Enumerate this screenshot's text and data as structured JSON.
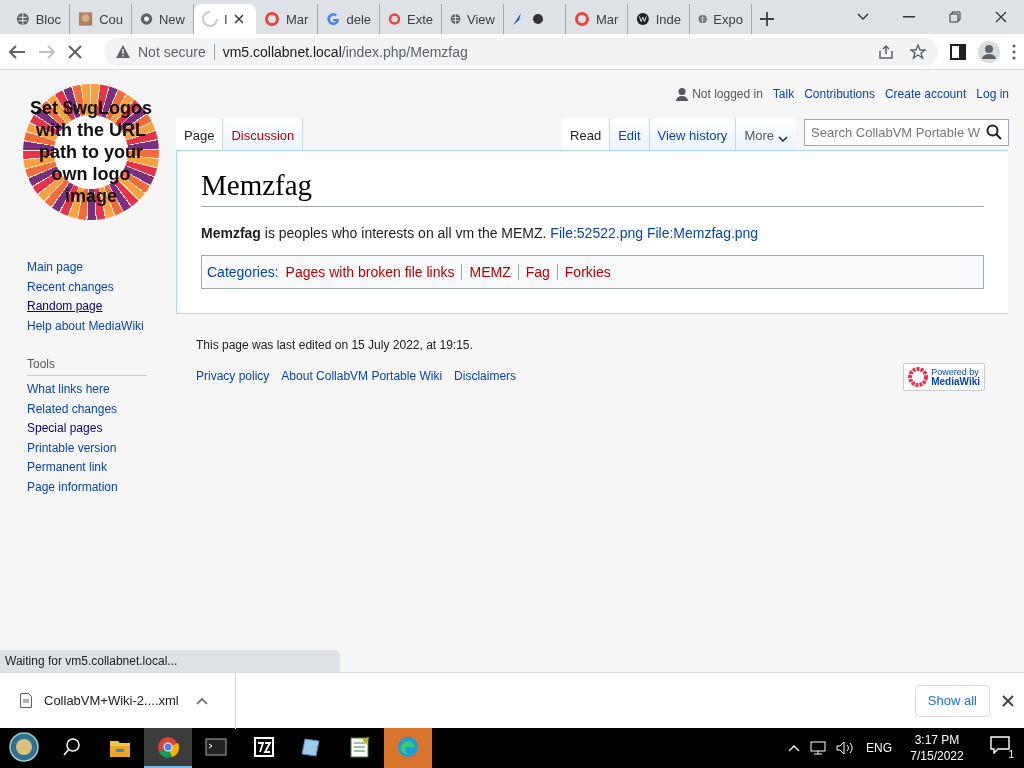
{
  "browser": {
    "tabs": [
      {
        "title": "Bloc",
        "kind": "globe",
        "selected": false
      },
      {
        "title": "Cou",
        "kind": "photo",
        "selected": false
      },
      {
        "title": "New",
        "kind": "chrome",
        "selected": false
      },
      {
        "title": "I",
        "kind": "loading",
        "selected": true
      },
      {
        "title": "Mar",
        "kind": "ring",
        "selected": false
      },
      {
        "title": "dele",
        "kind": "google",
        "selected": false
      },
      {
        "title": "Exte",
        "kind": "ring",
        "selected": false
      },
      {
        "title": "View",
        "kind": "globe",
        "selected": false
      },
      {
        "kind": "pair",
        "selected": false
      },
      {
        "title": "Mar",
        "kind": "ring",
        "selected": false
      },
      {
        "title": "Inde",
        "kind": "wiki",
        "selected": false
      },
      {
        "title": "Expo",
        "kind": "globe",
        "selected": false
      }
    ],
    "security": "Not secure",
    "url_host": "vm5.collabnet.local",
    "url_path": "/index.php/Memzfag",
    "loading": true
  },
  "wiki": {
    "logo_text": "Set $wgLogos with the URL path to your own logo image",
    "navigation": [
      {
        "label": "Main page",
        "hovered": false
      },
      {
        "label": "Recent changes",
        "hovered": false
      },
      {
        "label": "Random page",
        "hovered": true
      },
      {
        "label": "Help about MediaWiki",
        "hovered": false
      }
    ],
    "tools_heading": "Tools",
    "tools": [
      {
        "label": "What links here",
        "visited": false
      },
      {
        "label": "Related changes",
        "visited": false
      },
      {
        "label": "Special pages",
        "visited": true
      },
      {
        "label": "Printable version",
        "visited": false
      },
      {
        "label": "Permanent link",
        "visited": false
      },
      {
        "label": "Page information",
        "visited": false
      }
    ],
    "personal": {
      "status": "Not logged in",
      "links": [
        "Talk",
        "Contributions",
        "Create account",
        "Log in"
      ]
    },
    "namespace_tabs": [
      {
        "label": "Page",
        "selected": true
      },
      {
        "label": "Discussion",
        "selected": false
      }
    ],
    "view_tabs": [
      {
        "label": "Read",
        "selected": true
      },
      {
        "label": "Edit",
        "selected": false
      },
      {
        "label": "View history",
        "selected": false
      }
    ],
    "more": "More",
    "search_placeholder": "Search CollabVM Portable W",
    "title": "Memzfag",
    "body": "**Memzfag** is peoples who interests on all vm the MEMZ.",
    "body_links": [
      {
        "label": "File:52522.png"
      },
      {
        "label": "File:Memzfag.png"
      }
    ],
    "categories_label": "Categories:",
    "categories": [
      {
        "label": "Pages with broken file links",
        "missing": true
      },
      {
        "label": "MEMZ",
        "missing": true
      },
      {
        "label": "Fag",
        "missing": true
      },
      {
        "label": "Forkies",
        "missing": true
      }
    ],
    "last_edited": "This page was last edited on 15 July 2022, at 19:15.",
    "footer_links": [
      "Privacy policy",
      "About CollabVM Portable Wiki",
      "Disclaimers"
    ],
    "powered_by": [
      "Powered by",
      "MediaWiki"
    ]
  },
  "status_bubble": "Waiting for vm5.collabnet.local...",
  "download": {
    "file": "CollabVM+Wiki-2....xml",
    "show_all": "Show all"
  },
  "taskbar": {
    "apps": [
      {
        "kind": "explorer",
        "active": false
      },
      {
        "kind": "chrome",
        "active": true
      },
      {
        "kind": "terminal",
        "active": false
      },
      {
        "kind": "sevenzip",
        "active": false
      },
      {
        "kind": "notepad",
        "active": false
      },
      {
        "kind": "sheet",
        "active": false
      },
      {
        "kind": "edge",
        "active": false,
        "flashing": true
      }
    ],
    "language": "ENG",
    "time": "3:17 PM",
    "date": "7/15/2022",
    "notifications": "1"
  }
}
